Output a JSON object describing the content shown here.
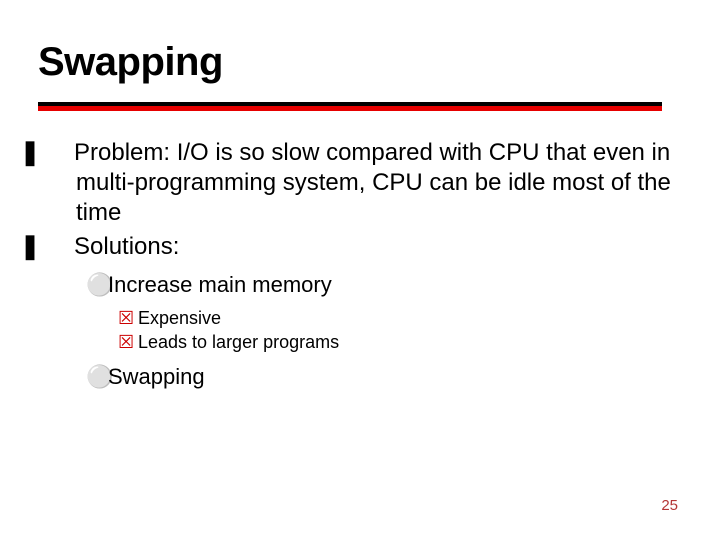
{
  "title": "Swapping",
  "bullets": {
    "level1": [
      {
        "glyph": "❚",
        "text": "Problem:  I/O is so slow compared with CPU that even in multi-programming system, CPU can be idle most of the time"
      },
      {
        "glyph": "❚",
        "text": "Solutions:"
      }
    ],
    "level2": [
      {
        "glyph": "⚪",
        "text": "Increase main memory"
      },
      {
        "glyph": "⚪",
        "text": "Swapping"
      }
    ],
    "level3": [
      {
        "glyph": "☒",
        "text": "Expensive"
      },
      {
        "glyph": "☒",
        "text": "Leads to larger programs"
      }
    ]
  },
  "page_number": "25",
  "colors": {
    "accent_red": "#e60000",
    "bullet_red": "#cc0000",
    "pagenum": "#b33636"
  }
}
